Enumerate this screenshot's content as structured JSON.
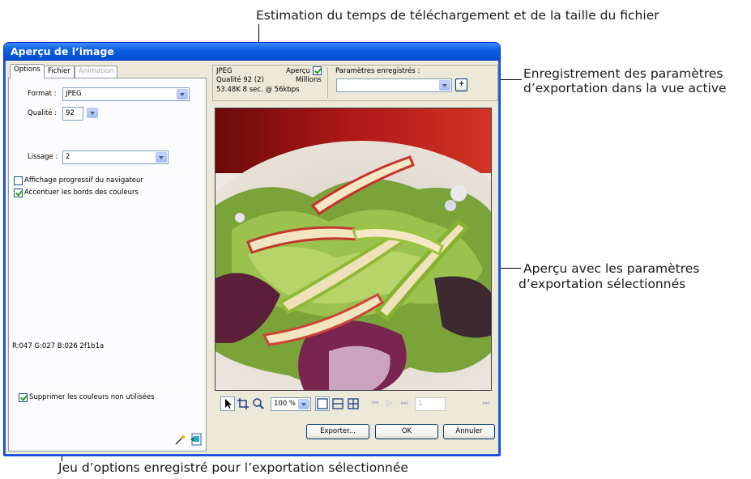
{
  "callouts": {
    "top": "Estimation du temps de téléchargement et de la taille du fichier",
    "right1_line1": "Enregistrement des paramètres",
    "right1_line2": "d’exportation dans la vue active",
    "right2_line1": "Aperçu avec les paramètres",
    "right2_line2": "d’exportation sélectionnés",
    "bottom": "Jeu d’options enregistré pour l’exportation sélectionnée"
  },
  "window": {
    "title": "Aperçu de l’image"
  },
  "tabs": [
    {
      "label": "Options",
      "state": "active"
    },
    {
      "label": "Fichier",
      "state": "normal"
    },
    {
      "label": "Animation",
      "state": "disabled"
    }
  ],
  "options": {
    "format_label": "Format :",
    "format_value": "JPEG",
    "quality_label": "Qualité :",
    "quality_value": "92",
    "smoothing_label": "Lissage :",
    "smoothing_value": "2",
    "progressive_label": "Affichage progressif du navigateur",
    "progressive_checked": false,
    "sharpen_label": "Accentuer les bords des couleurs",
    "sharpen_checked": true,
    "color_readout": "R:047 G:027 B:026 2f1b1a",
    "remove_unused_label": "Supprimer les couleurs non utilisées",
    "remove_unused_checked": true
  },
  "info": {
    "format": "JPEG",
    "quality": "Qualité 92 (2)",
    "size_time": "53.48K  8 sec. @ 56kbps",
    "preview_label": "Aperçu",
    "preview_checked": true,
    "colors": "Millions",
    "saved_settings_label": "Paramètres enregistrés :",
    "saved_settings_value": "",
    "add_button": "+"
  },
  "toolbar": {
    "zoom_value": "100 %",
    "frame_value": "1"
  },
  "buttons": {
    "export": "Exporter...",
    "ok": "OK",
    "cancel": "Annuler"
  },
  "colors": {
    "title_bar": "#0a5ee0",
    "dialog_bg": "#ece9d8",
    "check_green": "#21a121"
  }
}
